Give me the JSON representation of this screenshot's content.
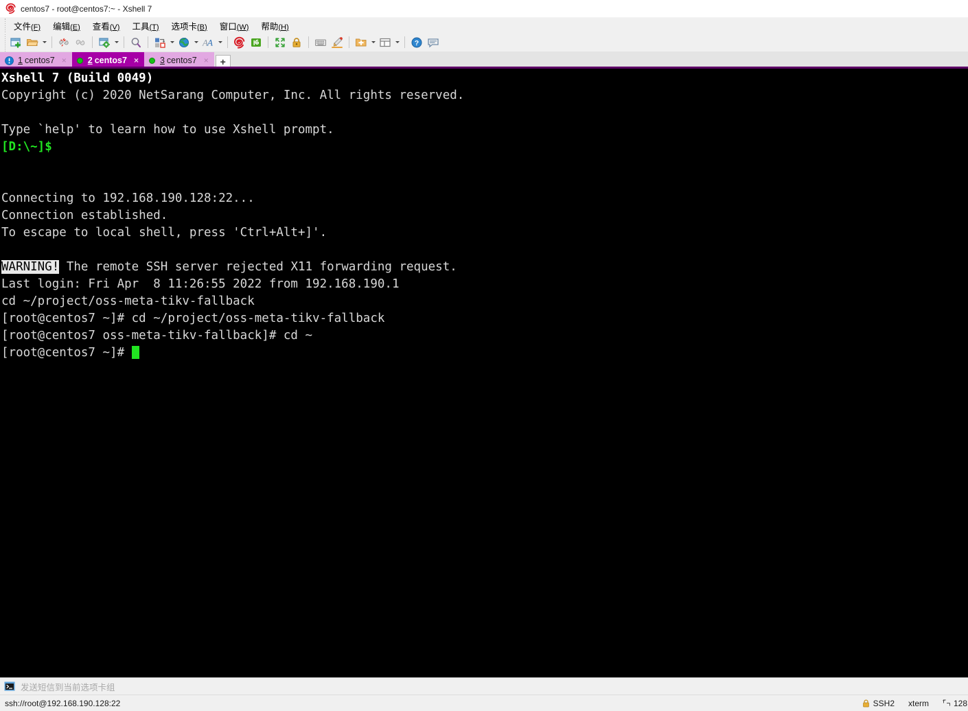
{
  "window": {
    "title": "centos7 - root@centos7:~ - Xshell 7",
    "app_icon": "xshell-spiral-icon"
  },
  "menubar": {
    "items": [
      {
        "label": "文件",
        "accel": "(F)",
        "name": "menu-file"
      },
      {
        "label": "编辑",
        "accel": "(E)",
        "name": "menu-edit"
      },
      {
        "label": "查看",
        "accel": "(V)",
        "name": "menu-view"
      },
      {
        "label": "工具",
        "accel": "(T)",
        "name": "menu-tools"
      },
      {
        "label": "选项卡",
        "accel": "(B)",
        "name": "menu-tabs"
      },
      {
        "label": "窗口",
        "accel": "(W)",
        "name": "menu-window"
      },
      {
        "label": "帮助",
        "accel": "(H)",
        "name": "menu-help"
      }
    ]
  },
  "toolbar": {
    "buttons": [
      "new-session-icon",
      "open-folder-icon",
      "folder-dropdown-caret",
      "separator",
      "disconnect-icon",
      "reconnect-icon",
      "separator",
      "session-properties-icon",
      "properties-dropdown-caret",
      "separator",
      "find-icon",
      "separator",
      "transfer-icon",
      "transfer-dropdown-caret",
      "globe-icon",
      "globe-dropdown-caret",
      "font-icon",
      "font-dropdown-caret",
      "separator",
      "xshell-spiral-icon",
      "xftp-icon",
      "separator",
      "fullscreen-icon",
      "lock-icon",
      "separator",
      "keyboard-icon",
      "highlight-pen-icon",
      "separator",
      "add-to-folder-icon",
      "add-folder-dropdown-caret",
      "layout-icon",
      "layout-dropdown-caret",
      "separator",
      "help-icon",
      "feedback-icon"
    ]
  },
  "tabs": {
    "items": [
      {
        "number": "1",
        "label": "centos7",
        "state": "inactive",
        "icon": "warning-exclamation-icon",
        "closable": true
      },
      {
        "number": "2",
        "label": "centos7",
        "state": "active",
        "icon": "connected-dot-icon",
        "closable": true
      },
      {
        "number": "3",
        "label": "centos7",
        "state": "inactive",
        "icon": "connected-dot-icon",
        "closable": true
      }
    ],
    "new_tab_label": "+"
  },
  "terminal": {
    "lines": [
      {
        "type": "bold",
        "text": "Xshell 7 (Build 0049)"
      },
      {
        "type": "plain",
        "text": "Copyright (c) 2020 NetSarang Computer, Inc. All rights reserved."
      },
      {
        "type": "blank",
        "text": ""
      },
      {
        "type": "plain",
        "text": "Type `help' to learn how to use Xshell prompt."
      },
      {
        "type": "green",
        "text": "[D:\\~]$"
      },
      {
        "type": "blank",
        "text": ""
      },
      {
        "type": "blank",
        "text": ""
      },
      {
        "type": "plain",
        "text": "Connecting to 192.168.190.128:22..."
      },
      {
        "type": "plain",
        "text": "Connection established."
      },
      {
        "type": "plain",
        "text": "To escape to local shell, press 'Ctrl+Alt+]'."
      },
      {
        "type": "blank",
        "text": ""
      },
      {
        "type": "warning",
        "badge": "WARNING!",
        "text": " The remote SSH server rejected X11 forwarding request."
      },
      {
        "type": "plain",
        "text": "Last login: Fri Apr  8 11:26:55 2022 from 192.168.190.1"
      },
      {
        "type": "plain",
        "text": "cd ~/project/oss-meta-tikv-fallback"
      },
      {
        "type": "plain",
        "text": "[root@centos7 ~]# cd ~/project/oss-meta-tikv-fallback"
      },
      {
        "type": "plain",
        "text": "[root@centos7 oss-meta-tikv-fallback]# cd ~"
      },
      {
        "type": "cursor",
        "text": "[root@centos7 ~]# "
      }
    ],
    "background": "#000000",
    "foreground": "#d8d8d8",
    "green": "#21e421",
    "cursor_color": "#21e421"
  },
  "command_bar": {
    "icon": "send-command-icon",
    "placeholder": "发送短信到当前选项卡组",
    "value": ""
  },
  "statusbar": {
    "connection": "ssh://root@192.168.190.128:22",
    "protocol": "SSH2",
    "terminal_type": "xterm",
    "size": "128",
    "lock_icon": "lock-icon",
    "size_icon": "terminal-size-icon"
  }
}
